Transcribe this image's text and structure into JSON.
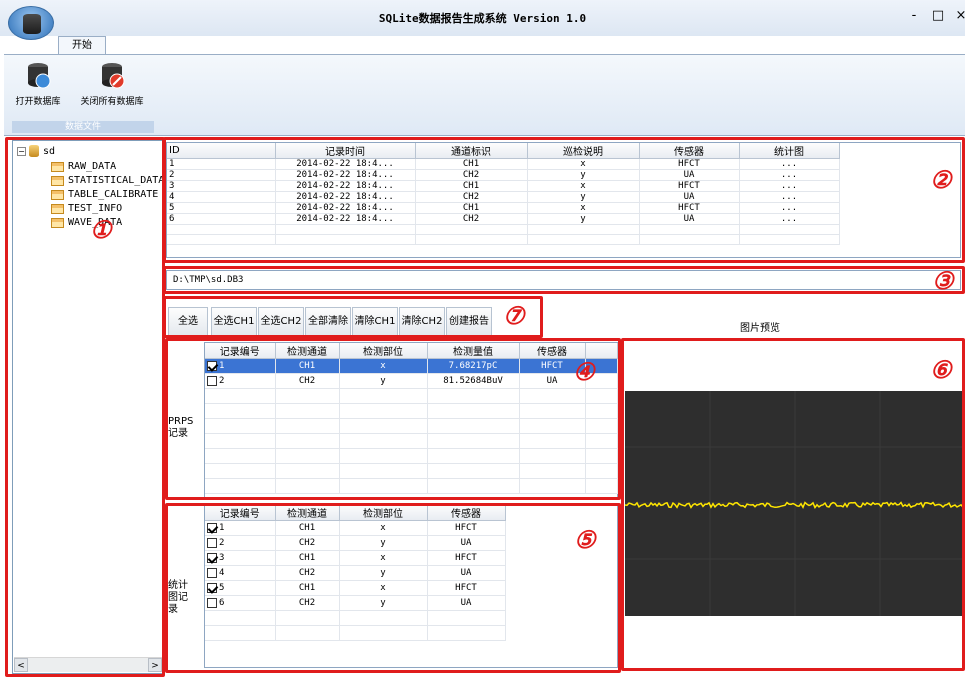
{
  "app": {
    "title": "SQLite数据报告生成系统 Version 1.0",
    "min_label": "-",
    "max_label": "□",
    "close_label": "×",
    "ribbon_tab": "开始",
    "open_db_label": "打开数据库",
    "close_all_label": "关闭所有数据库",
    "group_label": "数据文件"
  },
  "tree": {
    "root": "sd",
    "tables": [
      "RAW_DATA",
      "STATISTICAL_DATA",
      "TABLE_CALIBRATE",
      "TEST_INFO",
      "WAVE_DATA"
    ]
  },
  "records": {
    "headers": [
      "ID",
      "记录时间",
      "通道标识",
      "巡检说明",
      "传感器",
      "统计图"
    ],
    "rows": [
      [
        "1",
        "2014-02-22 18:4...",
        "CH1",
        "x",
        "HFCT",
        "..."
      ],
      [
        "2",
        "2014-02-22 18:4...",
        "CH2",
        "y",
        "UA",
        "..."
      ],
      [
        "3",
        "2014-02-22 18:4...",
        "CH1",
        "x",
        "HFCT",
        "..."
      ],
      [
        "4",
        "2014-02-22 18:4...",
        "CH2",
        "y",
        "UA",
        "..."
      ],
      [
        "5",
        "2014-02-22 18:4...",
        "CH1",
        "x",
        "HFCT",
        "..."
      ],
      [
        "6",
        "2014-02-22 18:4...",
        "CH2",
        "y",
        "UA",
        "..."
      ]
    ]
  },
  "path": "D:\\TMP\\sd.DB3",
  "buttons": [
    "全选",
    "全选CH1",
    "全选CH2",
    "全部清除",
    "清除CH1",
    "清除CH2",
    "创建报告"
  ],
  "prps": {
    "side_label": "PRPS记录",
    "headers": [
      "记录编号",
      "检测通道",
      "检测部位",
      "检测量值",
      "传感器"
    ],
    "rows": [
      {
        "checked": true,
        "id": "1",
        "ch": "CH1",
        "pos": "x",
        "val": "7.68217pC",
        "sensor": "HFCT"
      },
      {
        "checked": false,
        "id": "2",
        "ch": "CH2",
        "pos": "y",
        "val": "81.52684BuV",
        "sensor": "UA"
      }
    ]
  },
  "stats": {
    "side_label": "统计图记录",
    "headers": [
      "记录编号",
      "检测通道",
      "检测部位",
      "传感器"
    ],
    "rows": [
      {
        "checked": true,
        "id": "1",
        "ch": "CH1",
        "pos": "x",
        "sensor": "HFCT"
      },
      {
        "checked": false,
        "id": "2",
        "ch": "CH2",
        "pos": "y",
        "sensor": "UA"
      },
      {
        "checked": true,
        "id": "3",
        "ch": "CH1",
        "pos": "x",
        "sensor": "HFCT"
      },
      {
        "checked": false,
        "id": "4",
        "ch": "CH2",
        "pos": "y",
        "sensor": "UA"
      },
      {
        "checked": true,
        "id": "5",
        "ch": "CH1",
        "pos": "x",
        "sensor": "HFCT"
      },
      {
        "checked": false,
        "id": "6",
        "ch": "CH2",
        "pos": "y",
        "sensor": "UA"
      }
    ]
  },
  "preview_label": "图片预览",
  "annotations": [
    "①",
    "②",
    "③",
    "④",
    "⑤",
    "⑥",
    "⑦"
  ],
  "colors": {
    "annotation": "#e01c1c",
    "selection": "#3b74d3",
    "waveform": "#ffe600"
  }
}
